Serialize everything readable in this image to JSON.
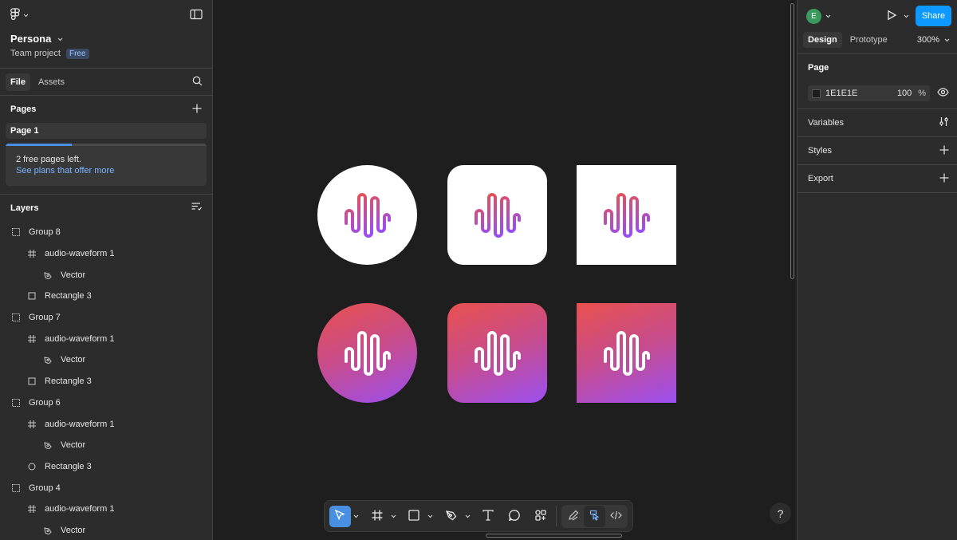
{
  "left": {
    "project_name": "Persona",
    "team": "Team project",
    "plan_badge": "Free",
    "tabs": [
      {
        "label": "File"
      },
      {
        "label": "Assets"
      }
    ],
    "pages_title": "Pages",
    "pages": [
      {
        "label": "Page 1"
      }
    ],
    "free_notice": {
      "text": "2 free pages left.",
      "link": "See plans that offer more",
      "progress": 0.33
    },
    "layers_title": "Layers",
    "layers": [
      {
        "label": "Group 8",
        "icon": "group-icon",
        "level": 0
      },
      {
        "label": "audio-waveform 1",
        "icon": "frame-icon",
        "level": 1
      },
      {
        "label": "Vector",
        "icon": "vector-icon",
        "level": 2
      },
      {
        "label": "Rectangle 3",
        "icon": "rectangle-icon",
        "level": 1
      },
      {
        "label": "Group 7",
        "icon": "group-icon",
        "level": 0
      },
      {
        "label": "audio-waveform 1",
        "icon": "frame-icon",
        "level": 1
      },
      {
        "label": "Vector",
        "icon": "vector-icon",
        "level": 2
      },
      {
        "label": "Rectangle 3",
        "icon": "rectangle-icon",
        "level": 1
      },
      {
        "label": "Group 6",
        "icon": "group-icon",
        "level": 0
      },
      {
        "label": "audio-waveform 1",
        "icon": "frame-icon",
        "level": 1
      },
      {
        "label": "Vector",
        "icon": "vector-icon",
        "level": 2
      },
      {
        "label": "Rectangle 3",
        "icon": "ellipse-icon",
        "level": 1
      },
      {
        "label": "Group 4",
        "icon": "group-icon",
        "level": 0
      },
      {
        "label": "audio-waveform 1",
        "icon": "frame-icon",
        "level": 1
      },
      {
        "label": "Vector",
        "icon": "vector-icon",
        "level": 2
      }
    ]
  },
  "canvas": {
    "colors": {
      "gradient_start": "#e9514d",
      "gradient_end": "#9b4ef0",
      "white": "#ffffff"
    },
    "icons": [
      {
        "shape": "circle",
        "fill": "white"
      },
      {
        "shape": "rounded",
        "fill": "white"
      },
      {
        "shape": "square",
        "fill": "white"
      },
      {
        "shape": "circle",
        "fill": "gradient"
      },
      {
        "shape": "rounded",
        "fill": "gradient"
      },
      {
        "shape": "square",
        "fill": "gradient"
      }
    ],
    "toolbar": [
      "move-tool",
      "frame-tool",
      "rectangle-tool",
      "pen-tool",
      "text-tool",
      "comment-tool",
      "actions-tool",
      "draw-mode",
      "design-mode",
      "dev-mode"
    ],
    "help_label": "?"
  },
  "right": {
    "avatar_initial": "E",
    "share_label": "Share",
    "tabs": [
      {
        "label": "Design"
      },
      {
        "label": "Prototype"
      }
    ],
    "zoom": "300%",
    "page_title": "Page",
    "page_bg_hex": "1E1E1E",
    "page_bg_opacity": "100",
    "page_bg_unit": "%",
    "sections": [
      {
        "label": "Variables"
      },
      {
        "label": "Styles"
      },
      {
        "label": "Export"
      }
    ]
  }
}
